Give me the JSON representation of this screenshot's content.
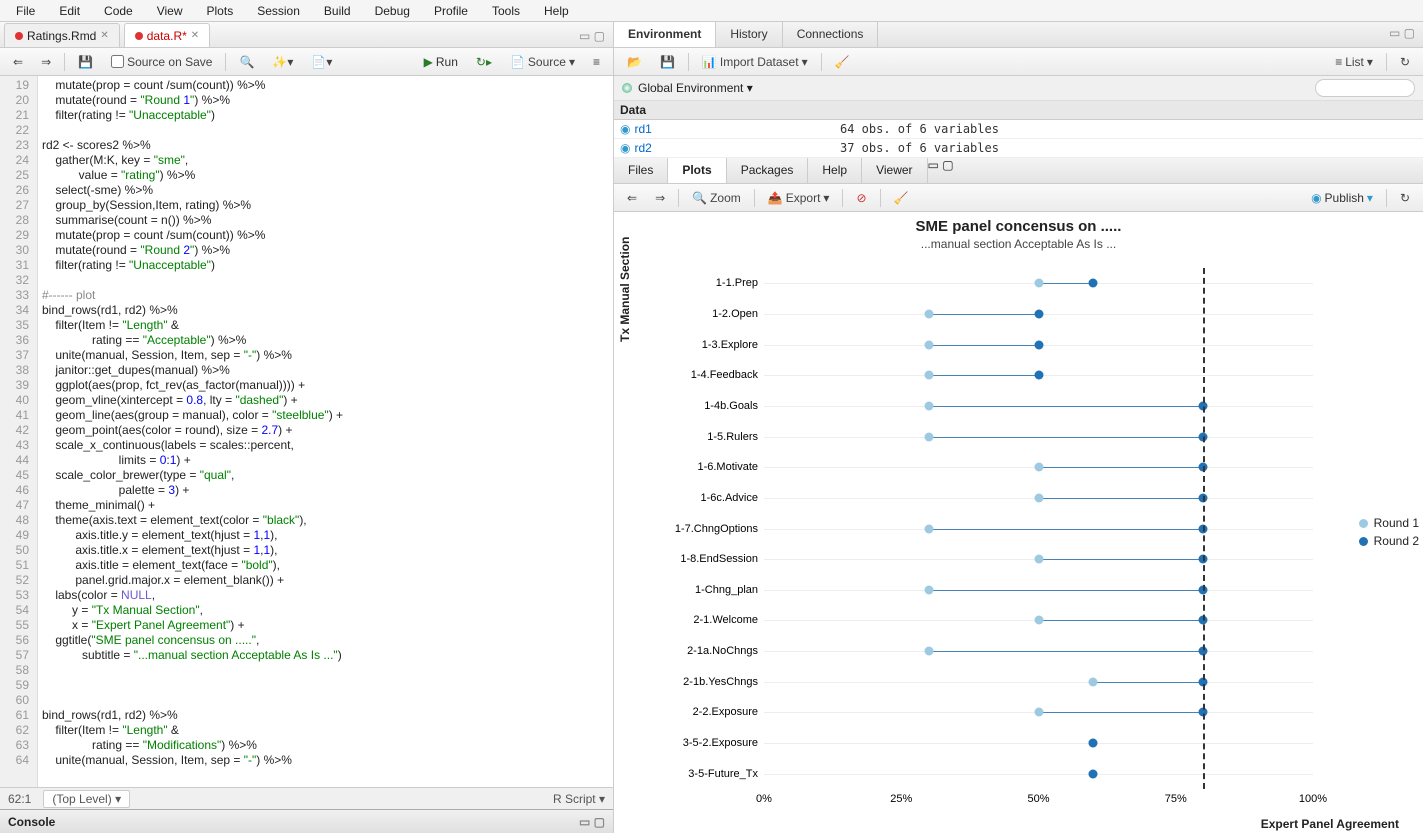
{
  "menu": {
    "items": [
      "File",
      "Edit",
      "Code",
      "View",
      "Plots",
      "Session",
      "Build",
      "Debug",
      "Profile",
      "Tools",
      "Help"
    ]
  },
  "source": {
    "tabs": [
      {
        "label": "Ratings.Rmd",
        "dirty": false
      },
      {
        "label": "data.R*",
        "dirty": true,
        "active": true
      }
    ],
    "toolbar": {
      "sourceOnSave": "Source on Save",
      "run": "Run",
      "source": "Source"
    },
    "status": {
      "pos": "62:1",
      "scope": "(Top Level)",
      "lang": "R Script"
    },
    "first_line": 19,
    "lines": [
      "    mutate(prop = count /sum(count)) %>%",
      "    mutate(round = \"Round 1\") %>%",
      "    filter(rating != \"Unacceptable\")",
      "",
      "rd2 <- scores2 %>%",
      "    gather(M:K, key = \"sme\",",
      "           value = \"rating\") %>%",
      "    select(-sme) %>%",
      "    group_by(Session,Item, rating) %>%",
      "    summarise(count = n()) %>%",
      "    mutate(prop = count /sum(count)) %>%",
      "    mutate(round = \"Round 2\") %>%",
      "    filter(rating != \"Unacceptable\")",
      "",
      "#------ plot",
      "bind_rows(rd1, rd2) %>%",
      "    filter(Item != \"Length\" &",
      "               rating == \"Acceptable\") %>%",
      "    unite(manual, Session, Item, sep = \"-\") %>%",
      "    janitor::get_dupes(manual) %>%",
      "    ggplot(aes(prop, fct_rev(as_factor(manual)))) +",
      "    geom_vline(xintercept = 0.8, lty = \"dashed\") +",
      "    geom_line(aes(group = manual), color = \"steelblue\") +",
      "    geom_point(aes(color = round), size = 2.7) +",
      "    scale_x_continuous(labels = scales::percent,",
      "                       limits = 0:1) +",
      "    scale_color_brewer(type = \"qual\",",
      "                       palette = 3) +",
      "    theme_minimal() +",
      "    theme(axis.text = element_text(color = \"black\"),",
      "          axis.title.y = element_text(hjust = 1,1),",
      "          axis.title.x = element_text(hjust = 1,1),",
      "          axis.title = element_text(face = \"bold\"),",
      "          panel.grid.major.x = element_blank()) +",
      "    labs(color = NULL,",
      "         y = \"Tx Manual Section\",",
      "         x = \"Expert Panel Agreement\") +",
      "    ggtitle(\"SME panel concensus on .....\",",
      "            subtitle = \"...manual section Acceptable As Is ...\")",
      "",
      "",
      "",
      "bind_rows(rd1, rd2) %>%",
      "    filter(Item != \"Length\" &",
      "               rating == \"Modifications\") %>%",
      "    unite(manual, Session, Item, sep = \"-\") %>%"
    ]
  },
  "console": {
    "label": "Console"
  },
  "env": {
    "tabs": [
      "Environment",
      "History",
      "Connections"
    ],
    "import": "Import Dataset",
    "list": "List",
    "scope": "Global Environment",
    "section": "Data",
    "rows": [
      {
        "name": "rd1",
        "desc": "64 obs. of 6 variables"
      },
      {
        "name": "rd2",
        "desc": "37 obs. of 6 variables"
      }
    ]
  },
  "plots": {
    "tabs": [
      "Files",
      "Plots",
      "Packages",
      "Help",
      "Viewer"
    ],
    "zoom": "Zoom",
    "export": "Export",
    "publish": "Publish"
  },
  "chart_data": {
    "type": "dot-line",
    "title": "SME panel concensus on .....",
    "subtitle": "...manual section Acceptable As Is ...",
    "xlabel": "Expert Panel Agreement",
    "ylabel": "Tx Manual Section",
    "xlim": [
      0,
      1
    ],
    "xticks": [
      0,
      0.25,
      0.5,
      0.75,
      1
    ],
    "xtick_labels": [
      "0%",
      "25%",
      "50%",
      "75%",
      "100%"
    ],
    "vline": 0.8,
    "legend": [
      "Round 1",
      "Round 2"
    ],
    "categories": [
      "1-1.Prep",
      "1-2.Open",
      "1-3.Explore",
      "1-4.Feedback",
      "1-4b.Goals",
      "1-5.Rulers",
      "1-6.Motivate",
      "1-6c.Advice",
      "1-7.ChngOptions",
      "1-8.EndSession",
      "1-Chng_plan",
      "2-1.Welcome",
      "2-1a.NoChngs",
      "2-1b.YesChngs",
      "2-2.Exposure",
      "3-5-2.Exposure",
      "3-5-Future_Tx"
    ],
    "series": [
      {
        "name": "Round 1",
        "values": [
          0.5,
          0.3,
          0.3,
          0.3,
          0.3,
          0.3,
          0.5,
          0.5,
          0.3,
          0.5,
          0.3,
          0.5,
          0.3,
          0.6,
          0.5,
          0.6,
          0.6
        ]
      },
      {
        "name": "Round 2",
        "values": [
          0.6,
          0.5,
          0.5,
          0.5,
          0.8,
          0.8,
          0.8,
          0.8,
          0.8,
          0.8,
          0.8,
          0.8,
          0.8,
          0.8,
          0.8,
          0.6,
          0.6
        ]
      }
    ]
  }
}
